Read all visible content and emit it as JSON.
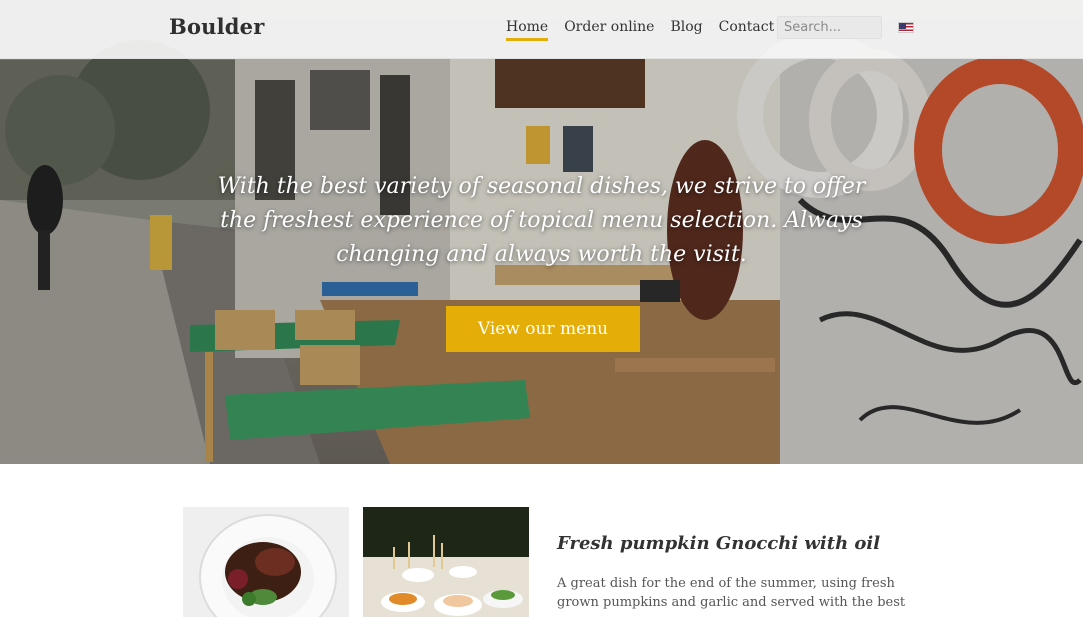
{
  "header": {
    "logo": "Boulder",
    "nav": [
      {
        "label": "Home",
        "active": true
      },
      {
        "label": "Order online",
        "active": false
      },
      {
        "label": "Blog",
        "active": false
      },
      {
        "label": "Contact",
        "active": false
      }
    ],
    "search_placeholder": "Search...",
    "language_icon": "us-flag-icon"
  },
  "hero": {
    "tagline": "With the best variety of seasonal dishes, we strive to offer the freshest experience of topical menu selection. Always changing and always worth the visit.",
    "cta_label": "View our menu"
  },
  "featured": {
    "title": "Fresh pumpkin Gnocchi with oil",
    "description": "A great dish for the end of the summer, using fresh grown pumpkins and garlic and served with the best"
  },
  "colors": {
    "accent": "#e5ad07",
    "header_bg": "#f6f6f6",
    "text": "#333333"
  }
}
